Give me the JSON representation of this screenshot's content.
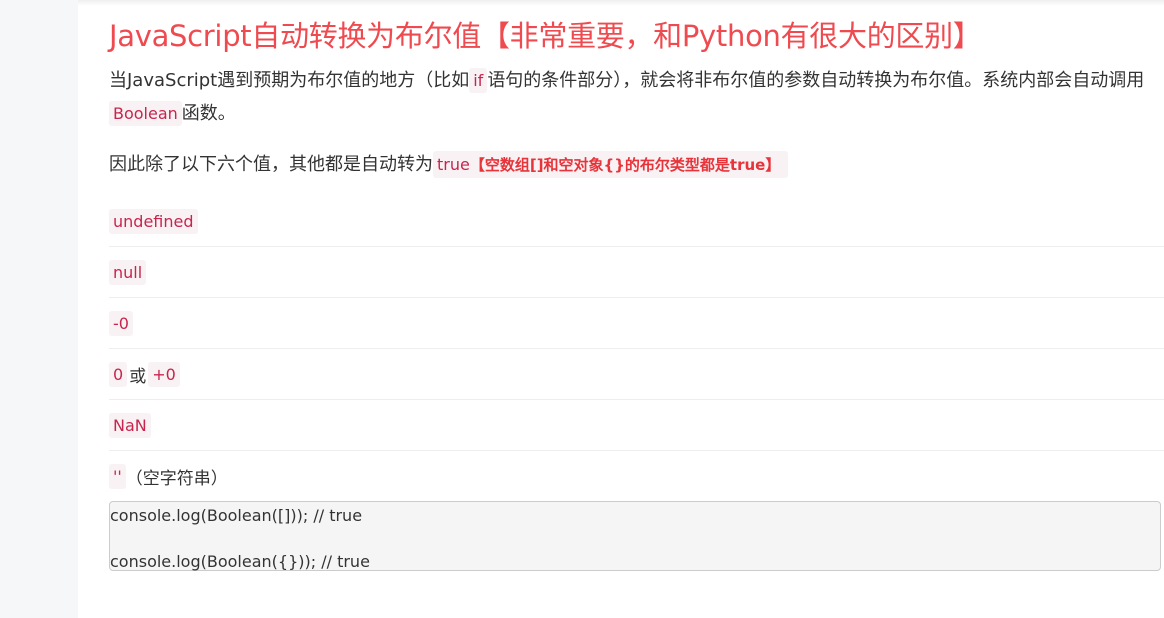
{
  "title": "JavaScript自动转换为布尔值【非常重要，和Python有很大的区别】",
  "paragraph1": {
    "before_if": "当JavaScript遇到预期为布尔值的地方（比如",
    "code_if": "if",
    "after_if": "语句的条件部分），就会将非布尔值的参数自动转换为布尔值。系统内部会自动调用",
    "code_boolean": "Boolean",
    "after_boolean": "函数。"
  },
  "paragraph2": {
    "text": "因此除了以下六个值，其他都是自动转为",
    "true_word": "true",
    "note": "【空数组[]和空对象{}的布尔类型都是true】"
  },
  "falsy_values": {
    "undefined": "undefined",
    "null": "null",
    "neg_zero": "-0",
    "zero": "0",
    "or_word": "或",
    "pos_zero": "+0",
    "nan": "NaN",
    "empty_string": "''",
    "empty_string_note": "（空字符串）"
  },
  "code_block": {
    "line1": "console.log(Boolean([])); // true",
    "line2": "",
    "line3": "console.log(Boolean({})); // true"
  }
}
